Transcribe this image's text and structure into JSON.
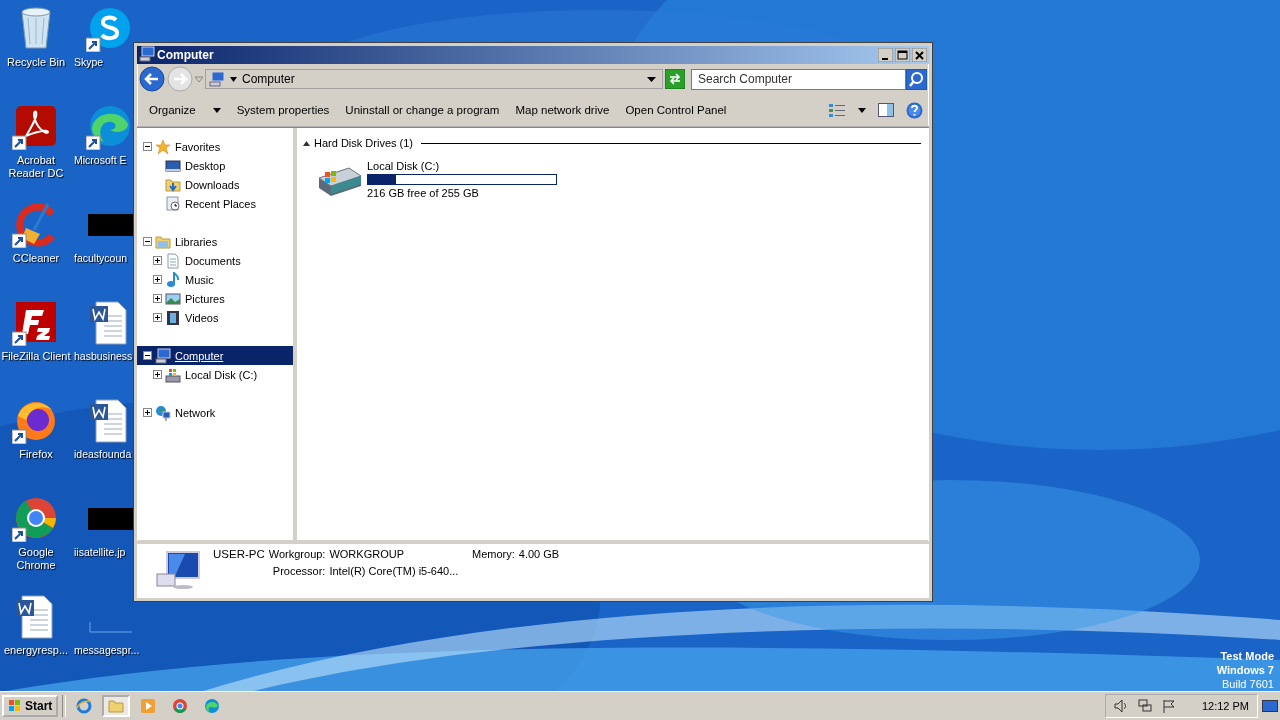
{
  "desktop": {
    "columns": [
      [
        {
          "label": "Recycle Bin",
          "kind": "recycle",
          "shortcut": false
        },
        {
          "label": "Acrobat Reader DC",
          "kind": "acrobat",
          "shortcut": true
        },
        {
          "label": "CCleaner",
          "kind": "ccleaner",
          "shortcut": true
        },
        {
          "label": "FileZilla Client",
          "kind": "filezilla",
          "shortcut": true
        },
        {
          "label": "Firefox",
          "kind": "firefox",
          "shortcut": true
        },
        {
          "label": "Google Chrome",
          "kind": "chrome",
          "shortcut": true
        },
        {
          "label": "energyresp...",
          "kind": "word",
          "shortcut": false
        }
      ],
      [
        {
          "label": "Skype",
          "kind": "skype",
          "shortcut": true
        },
        {
          "label": "Microsoft E",
          "kind": "edge",
          "shortcut": true
        },
        {
          "label": "facultycoun",
          "kind": "thumbnail",
          "shortcut": false
        },
        {
          "label": "hasbusiness",
          "kind": "word",
          "shortcut": false
        },
        {
          "label": "ideasfounda",
          "kind": "word",
          "shortcut": false
        },
        {
          "label": "iisatellite.jp",
          "kind": "thumbnail",
          "shortcut": false
        },
        {
          "label": "messagespr...",
          "kind": "blank",
          "shortcut": false
        }
      ]
    ],
    "system_notice": [
      "Test Mode",
      "Windows 7",
      "Build 7601"
    ]
  },
  "window": {
    "title": "Computer",
    "address": {
      "location": "Computer",
      "search_placeholder": "Search Computer"
    },
    "toolbar": [
      {
        "label": "Organize",
        "dropdown": true
      },
      {
        "label": "System properties",
        "dropdown": false
      },
      {
        "label": "Uninstall or change a program",
        "dropdown": false
      },
      {
        "label": "Map network drive",
        "dropdown": false
      },
      {
        "label": "Open Control Panel",
        "dropdown": false
      }
    ],
    "navigation": [
      {
        "label": "Favorites",
        "kind": "star",
        "expanded": true,
        "selected": false,
        "children": [
          {
            "label": "Desktop",
            "kind": "desktop",
            "selected": false
          },
          {
            "label": "Downloads",
            "kind": "downloads",
            "selected": false
          },
          {
            "label": "Recent Places",
            "kind": "recent",
            "selected": false
          }
        ]
      },
      {
        "label": "Libraries",
        "kind": "library",
        "expanded": true,
        "selected": false,
        "children": [
          {
            "label": "Documents",
            "kind": "documents",
            "expanded": false,
            "selected": false
          },
          {
            "label": "Music",
            "kind": "music",
            "expanded": false,
            "selected": false
          },
          {
            "label": "Pictures",
            "kind": "pictures",
            "expanded": false,
            "selected": false
          },
          {
            "label": "Videos",
            "kind": "videos",
            "expanded": false,
            "selected": false
          }
        ]
      },
      {
        "label": "Computer",
        "kind": "computer",
        "expanded": true,
        "selected": true,
        "children": [
          {
            "label": "Local Disk (C:)",
            "kind": "disk",
            "expanded": false,
            "selected": false
          }
        ]
      },
      {
        "label": "Network",
        "kind": "network",
        "expanded": false,
        "selected": false
      }
    ],
    "groups": [
      {
        "title": "Hard Disk Drives (1)",
        "expanded": true,
        "drives": [
          {
            "name": "Local Disk (C:)",
            "level": 0.15,
            "free": "216 GB free of 255 GB"
          }
        ]
      }
    ],
    "details": {
      "name": "USER-PC",
      "fields": [
        {
          "label": "Workgroup:",
          "value": "WORKGROUP"
        },
        {
          "label": "Memory:",
          "value": "4.00 GB"
        },
        {
          "label": "Processor:",
          "value": "Intel(R) Core(TM) i5-640..."
        }
      ]
    }
  },
  "taskbar": {
    "start": "Start",
    "apps": [
      {
        "kind": "ie",
        "selected": false
      },
      {
        "kind": "explorer",
        "selected": true
      },
      {
        "kind": "media",
        "selected": false
      },
      {
        "kind": "chrome",
        "selected": false
      },
      {
        "kind": "edge",
        "selected": false
      }
    ],
    "clock": "12:12 PM"
  }
}
